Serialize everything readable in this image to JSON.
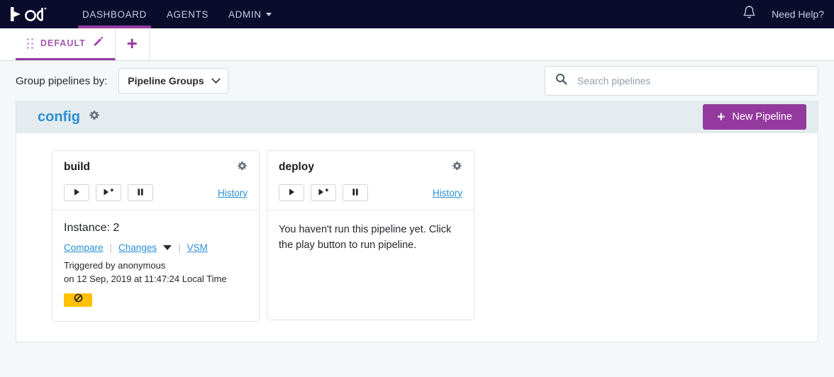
{
  "colors": {
    "navbar_bg": "#0b0b2c",
    "accent_purple": "#943a9e",
    "link_blue": "#2a8fd4",
    "group_header_bg": "#e4ecf0",
    "page_bg": "#f4f8fa",
    "status_yellow": "#ffc107"
  },
  "topnav": {
    "logo_text": "go",
    "logo_icon": "gocd-play-logo-icon",
    "links": [
      {
        "label": "DASHBOARD",
        "active": true
      },
      {
        "label": "AGENTS",
        "active": false
      },
      {
        "label": "ADMIN",
        "active": false,
        "has_caret": true
      }
    ],
    "bell_icon": "notification-bell-icon",
    "need_help_label": "Need Help?"
  },
  "tabstrip": {
    "drag_handle_icon": "drag-handle-dots-icon",
    "tab_label": "DEFAULT",
    "edit_icon": "pencil-edit-icon",
    "add_tab_label": "+"
  },
  "filterbar": {
    "group_by_label": "Group pipelines by:",
    "select_value": "Pipeline Groups",
    "select_caret_icon": "chevron-down-icon",
    "search_icon": "search-icon",
    "search_value": "",
    "search_placeholder": "Search pipelines"
  },
  "group": {
    "name": "config",
    "settings_icon": "gear-icon",
    "new_pipeline_label": "New Pipeline",
    "new_pipeline_plus": "+"
  },
  "pipelines": [
    {
      "name": "build",
      "settings_icon": "gear-icon",
      "buttons": [
        {
          "name": "play-button",
          "icon": "play-icon"
        },
        {
          "name": "play-with-options-button",
          "icon": "play-plus-icon"
        },
        {
          "name": "pause-button",
          "icon": "pause-icon"
        }
      ],
      "history_label": "History",
      "has_run": true,
      "instance_label": "Instance: 2",
      "compare_label": "Compare",
      "changes_label": "Changes",
      "changes_caret_icon": "triangle-down-icon",
      "vsm_label": "VSM",
      "triggered_by": "Triggered by anonymous",
      "triggered_on": "on 12 Sep, 2019 at 11:47:24 Local Time",
      "status_icon": "cancelled-no-entry-icon",
      "status_color": "#ffc107"
    },
    {
      "name": "deploy",
      "settings_icon": "gear-icon",
      "buttons": [
        {
          "name": "play-button",
          "icon": "play-icon"
        },
        {
          "name": "play-with-options-button",
          "icon": "play-plus-icon"
        },
        {
          "name": "pause-button",
          "icon": "pause-icon"
        }
      ],
      "history_label": "History",
      "has_run": false,
      "empty_message": "You haven't run this pipeline yet. Click the play button to run pipeline."
    }
  ]
}
